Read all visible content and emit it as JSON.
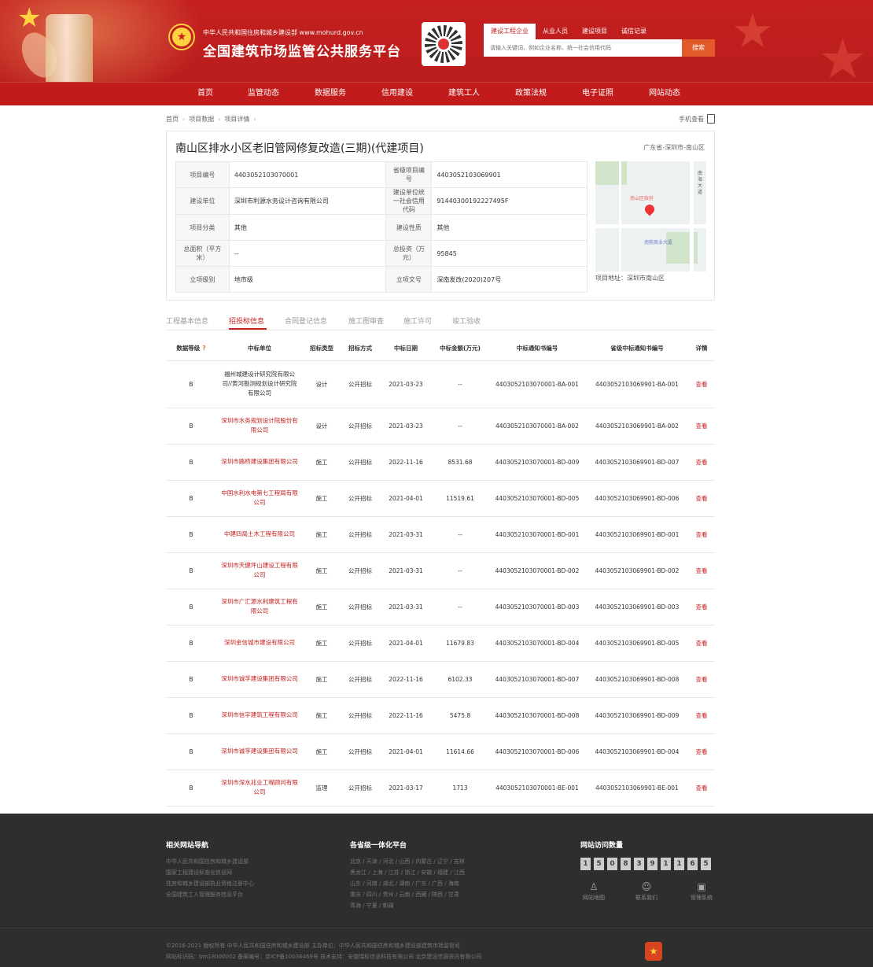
{
  "header": {
    "sub_title": "中华人民共和国住房和城乡建设部  www.mohurd.gov.cn",
    "title": "全国建筑市场监管公共服务平台",
    "search_tabs": [
      "建设工程企业",
      "从业人员",
      "建设项目",
      "诚信记录"
    ],
    "search_placeholder": "请输入关键词，例如企业名称、统一社会信用代码",
    "search_button": "搜索"
  },
  "nav": [
    "首页",
    "监管动态",
    "数据服务",
    "信用建设",
    "建筑工人",
    "政策法规",
    "电子证照",
    "网站动态"
  ],
  "breadcrumb": [
    "首页",
    "项目数据",
    "项目详情"
  ],
  "mobile_view": "手机查看",
  "project": {
    "title": "南山区排水小区老旧管网修复改造(三期)(代建项目)",
    "region": "广东省-深圳市-南山区",
    "fields": {
      "project_no_label": "项目编号",
      "project_no": "4403052103070001",
      "prov_no_label": "省级项目编号",
      "prov_no": "4403052103069901",
      "builder_label": "建设单位",
      "builder": "深圳市利源水务设计咨询有限公司",
      "credit_label": "建设单位统一社会信用代码",
      "credit": "91440300192227495F",
      "category_label": "项目分类",
      "category": "其他",
      "nature_label": "建设性质",
      "nature": "其他",
      "area_label": "总面积（平方米）",
      "area": "--",
      "invest_label": "总投资（万元）",
      "invest": "95845",
      "level_label": "立项级别",
      "level": "地市级",
      "doc_label": "立项文号",
      "doc": "深南发改(2020)207号"
    },
    "map_labels": [
      "南山区政府",
      "南航商业大厦",
      "南海大道"
    ],
    "address": "项目地址：深圳市南山区"
  },
  "tabs": [
    "工程基本信息",
    "招投标信息",
    "合同登记信息",
    "施工图审查",
    "施工许可",
    "竣工验收"
  ],
  "bids_headers": [
    "数据等级",
    "中标单位",
    "招标类型",
    "招标方式",
    "中标日期",
    "中标金额(万元)",
    "中标通知书编号",
    "省级中标通知书编号",
    "详情"
  ],
  "bids_help": "?",
  "bids": [
    {
      "grade": "B",
      "unit": "福州城建设计研究院有限公司//黄河勘测规划设计研究院有限公司",
      "type": "设计",
      "method": "公开招标",
      "date": "2021-03-23",
      "amount": "--",
      "notice": "4403052103070001-BA-001",
      "prov_notice": "4403052103069901-BA-001",
      "detail": "查看"
    },
    {
      "grade": "B",
      "unit": "深圳市水务规划设计院股份有限公司",
      "type": "设计",
      "method": "公开招标",
      "date": "2021-03-23",
      "amount": "--",
      "notice": "4403052103070001-BA-002",
      "prov_notice": "4403052103069901-BA-002",
      "detail": "查看"
    },
    {
      "grade": "B",
      "unit": "深圳市路桥建设集团有限公司",
      "type": "施工",
      "method": "公开招标",
      "date": "2022-11-16",
      "amount": "8531.68",
      "notice": "4403052103070001-BD-009",
      "prov_notice": "4403052103069901-BD-007",
      "detail": "查看"
    },
    {
      "grade": "B",
      "unit": "中国水利水电第七工程局有限公司",
      "type": "施工",
      "method": "公开招标",
      "date": "2021-04-01",
      "amount": "11519.61",
      "notice": "4403052103070001-BD-005",
      "prov_notice": "4403052103069901-BD-006",
      "detail": "查看"
    },
    {
      "grade": "B",
      "unit": "中建四局土木工程有限公司",
      "type": "施工",
      "method": "公开招标",
      "date": "2021-03-31",
      "amount": "--",
      "notice": "4403052103070001-BD-001",
      "prov_notice": "4403052103069901-BD-001",
      "detail": "查看"
    },
    {
      "grade": "B",
      "unit": "深圳市天健坪山建设工程有限公司",
      "type": "施工",
      "method": "公开招标",
      "date": "2021-03-31",
      "amount": "--",
      "notice": "4403052103070001-BD-002",
      "prov_notice": "4403052103069901-BD-002",
      "detail": "查看"
    },
    {
      "grade": "B",
      "unit": "深圳市广汇源水利建筑工程有限公司",
      "type": "施工",
      "method": "公开招标",
      "date": "2021-03-31",
      "amount": "--",
      "notice": "4403052103070001-BD-003",
      "prov_notice": "4403052103069901-BD-003",
      "detail": "查看"
    },
    {
      "grade": "B",
      "unit": "深圳金信城市建设有限公司",
      "type": "施工",
      "method": "公开招标",
      "date": "2021-04-01",
      "amount": "11679.83",
      "notice": "4403052103070001-BD-004",
      "prov_notice": "4403052103069901-BD-005",
      "detail": "查看"
    },
    {
      "grade": "B",
      "unit": "深圳市诚孚建设集团有限公司",
      "type": "施工",
      "method": "公开招标",
      "date": "2022-11-16",
      "amount": "6102.33",
      "notice": "4403052103070001-BD-007",
      "prov_notice": "4403052103069901-BD-008",
      "detail": "查看"
    },
    {
      "grade": "B",
      "unit": "深圳市信宇建筑工程有限公司",
      "type": "施工",
      "method": "公开招标",
      "date": "2022-11-16",
      "amount": "5475.8",
      "notice": "4403052103070001-BD-008",
      "prov_notice": "4403052103069901-BD-009",
      "detail": "查看"
    },
    {
      "grade": "B",
      "unit": "深圳市诚孚建设集团有限公司",
      "type": "施工",
      "method": "公开招标",
      "date": "2021-04-01",
      "amount": "11614.66",
      "notice": "4403052103070001-BD-006",
      "prov_notice": "4403052103069901-BD-004",
      "detail": "查看"
    },
    {
      "grade": "B",
      "unit": "深圳市深水兆业工程顾问有限公司",
      "type": "监理",
      "method": "公开招标",
      "date": "2021-03-17",
      "amount": "1713",
      "notice": "4403052103070001-BE-001",
      "prov_notice": "4403052103069901-BE-001",
      "detail": "查看"
    }
  ],
  "footer": {
    "links_title": "相关网站导航",
    "links": [
      "中华人民共和国住房和城乡建设部",
      "国家工程建设标准化信息网",
      "住房和城乡建设部执业资格注册中心",
      "全国建筑工人管理服务信息平台"
    ],
    "prov_title": "各省级一体化平台",
    "prov_lines": [
      "北京 / 天津 / 河北 / 山西 / 内蒙古 / 辽宁 / 吉林",
      "黑龙江 / 上海 / 江苏 / 浙江 / 安徽 / 福建 / 江西",
      "山东 / 河南 / 湖北 / 湖南 / 广东 / 广西 / 海南",
      "重庆 / 四川 / 贵州 / 云南 / 西藏 / 陕西 / 甘肃",
      "青海 / 宁夏 / 新疆"
    ],
    "visits_title": "网站访问数量",
    "visits_digits": [
      "1",
      "5",
      "0",
      "8",
      "3",
      "9",
      "1",
      "1",
      "6",
      "5"
    ],
    "icons": [
      "网站地图",
      "联系我们",
      "管理系统"
    ],
    "copyright": "©2016-2021 版权所有 中华人民共和国住房和城乡建设部   主办单位：中华人民共和国住房和城乡建设部建筑市场监管司",
    "icp": "网站标识码：bm18000002   备案编号：京ICP备10036469号   技术支持：安徽瑞标信息科技有限公司 北京建设信源资讯有限公司"
  }
}
